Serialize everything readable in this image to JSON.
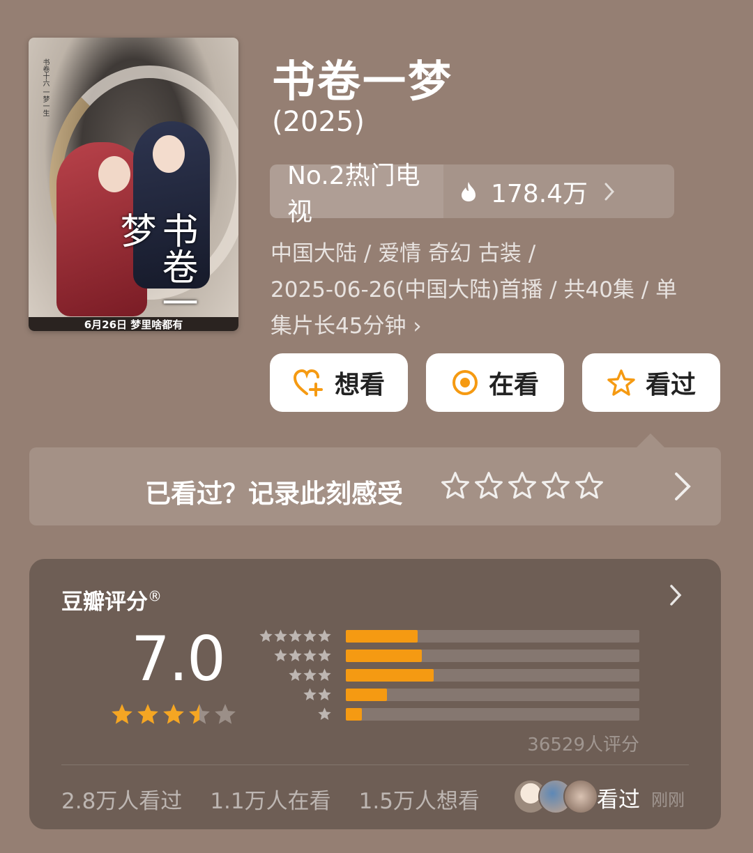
{
  "show": {
    "title": "书卷一梦",
    "year": "(2025)",
    "rank": "No.2热门电视",
    "heat": "178.4万",
    "meta_line1": "中国大陆 / 爱情 奇幻 古装 /",
    "meta_line2": "2025-06-26(中国大陆)首播 / 共40集 / 单",
    "meta_line3": "集片长45分钟 ›"
  },
  "poster": {
    "calligraphy": "书卷一梦",
    "vertical_text": "书卷十六 一梦一生",
    "caption": "6月26日 梦里啥都有"
  },
  "actions": {
    "want": "想看",
    "watching": "在看",
    "watched": "看过"
  },
  "record": {
    "prompt": "已看过？记录此刻感受"
  },
  "rating": {
    "title": "豆瓣评分",
    "reg_mark": "®",
    "score": "7.0",
    "stars_value": 3.5,
    "count_text": "36529人评分",
    "stats": [
      "2.8万人看过",
      "1.1万人在看",
      "1.5万人想看"
    ],
    "recent_label": "看过",
    "recent_time": "刚刚"
  },
  "chart_data": {
    "type": "bar",
    "categories": [
      "5星",
      "4星",
      "3星",
      "2星",
      "1星"
    ],
    "values": [
      24.5,
      26,
      30,
      14,
      5.5
    ],
    "ylim": [
      0,
      100
    ]
  },
  "colors": {
    "background": "#957f73",
    "card": "#6e5e55",
    "accent": "#f59a12",
    "star": "#f5a623"
  },
  "icons": [
    "heart-plus-icon",
    "target-icon",
    "star-icon",
    "fire-icon",
    "chevron-right-icon"
  ]
}
